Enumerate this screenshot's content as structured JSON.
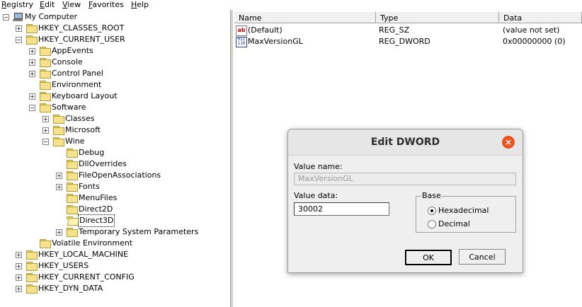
{
  "menubar": {
    "items": [
      {
        "prefix": "R",
        "rest": "egistry"
      },
      {
        "prefix": "E",
        "rest": "dit"
      },
      {
        "prefix": "V",
        "rest": "iew"
      },
      {
        "prefix": "F",
        "rest": "avorites"
      },
      {
        "prefix": "H",
        "rest": "elp"
      }
    ]
  },
  "tree": {
    "root": "My Computer",
    "nodes": [
      {
        "label": "HKEY_CLASSES_ROOT",
        "expander": "+"
      },
      {
        "label": "HKEY_CURRENT_USER",
        "expander": "−"
      },
      {
        "label": "AppEvents",
        "expander": "+"
      },
      {
        "label": "Console",
        "expander": "+"
      },
      {
        "label": "Control Panel",
        "expander": "+"
      },
      {
        "label": "Environment",
        "expander": ""
      },
      {
        "label": "Keyboard Layout",
        "expander": "+"
      },
      {
        "label": "Software",
        "expander": "−"
      },
      {
        "label": "Classes",
        "expander": "+"
      },
      {
        "label": "Microsoft",
        "expander": "+"
      },
      {
        "label": "Wine",
        "expander": "−"
      },
      {
        "label": "Debug",
        "expander": ""
      },
      {
        "label": "DllOverrides",
        "expander": ""
      },
      {
        "label": "FileOpenAssociations",
        "expander": "+"
      },
      {
        "label": "Fonts",
        "expander": "+"
      },
      {
        "label": "MenuFiles",
        "expander": ""
      },
      {
        "label": "Direct2D",
        "expander": ""
      },
      {
        "label": "Direct3D",
        "expander": ""
      },
      {
        "label": "Temporary System Parameters",
        "expander": "+"
      },
      {
        "label": "Volatile Environment",
        "expander": ""
      },
      {
        "label": "HKEY_LOCAL_MACHINE",
        "expander": "+"
      },
      {
        "label": "HKEY_USERS",
        "expander": "+"
      },
      {
        "label": "HKEY_CURRENT_CONFIG",
        "expander": "+"
      },
      {
        "label": "HKEY_DYN_DATA",
        "expander": "+"
      }
    ]
  },
  "list": {
    "columns": [
      "Name",
      "Type",
      "Data"
    ],
    "rows": [
      {
        "icon": "string-value-icon",
        "icon_text": "ab",
        "name": "(Default)",
        "type": "REG_SZ",
        "data": "(value not set)"
      },
      {
        "icon": "binary-value-icon",
        "icon_text": "011 110",
        "name": "MaxVersionGL",
        "type": "REG_DWORD",
        "data": "0x00000000 (0)"
      }
    ]
  },
  "dialog": {
    "title": "Edit DWORD",
    "close_symbol": "×",
    "value_name_label": "Value name:",
    "value_name": "MaxVersionGL",
    "value_data_label": "Value data:",
    "value_data": "30002",
    "base_label": "Base",
    "hex_label": "Hexadecimal",
    "dec_label": "Decimal",
    "selected_base": "Hexadecimal",
    "ok_label": "OK",
    "cancel_label": "Cancel"
  },
  "colors": {
    "close_button": "#e95420",
    "folder": "#f5e28c"
  }
}
